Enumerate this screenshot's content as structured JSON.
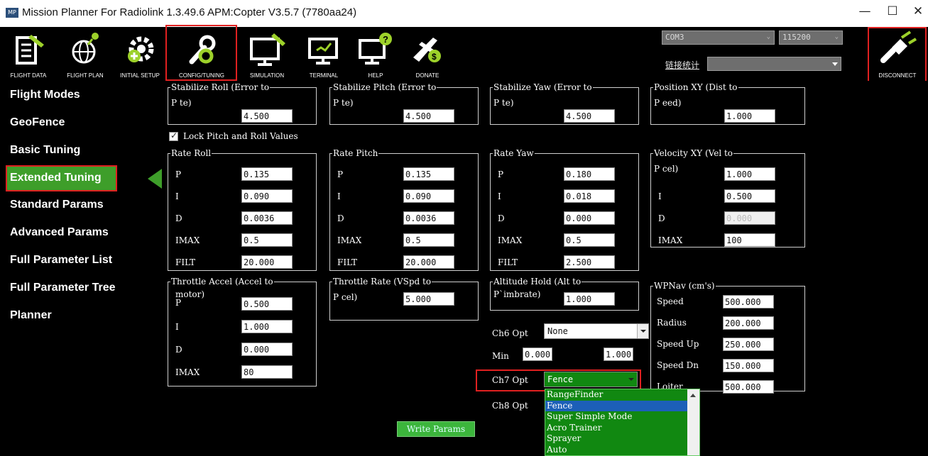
{
  "window": {
    "title": "Mission Planner For Radiolink 1.3.49.6 APM:Copter V3.5.7 (7780aa24)",
    "app_icon_text": "MP",
    "minimize": "—",
    "maximize": "☐",
    "close": "✕"
  },
  "toolbar": {
    "buttons": [
      {
        "label": "FLIGHT DATA",
        "icon": "flight-data-icon"
      },
      {
        "label": "FLIGHT PLAN",
        "icon": "flight-plan-icon"
      },
      {
        "label": "INITIAL SETUP",
        "icon": "initial-setup-icon"
      },
      {
        "label": "CONFIG/TUNING",
        "icon": "config-tuning-icon"
      },
      {
        "label": "SIMULATION",
        "icon": "simulation-icon"
      },
      {
        "label": "TERMINAL",
        "icon": "terminal-icon"
      },
      {
        "label": "HELP",
        "icon": "help-icon"
      },
      {
        "label": "DONATE",
        "icon": "donate-icon"
      }
    ],
    "com_port": "COM3",
    "baud_rate": "115200",
    "link_stats": "链接统计",
    "disconnect_label": "DISCONNECT"
  },
  "sidebar": {
    "items": [
      {
        "label": "Flight Modes"
      },
      {
        "label": "GeoFence"
      },
      {
        "label": "Basic Tuning"
      },
      {
        "label": "Extended Tuning"
      },
      {
        "label": "Standard Params"
      },
      {
        "label": "Advanced Params"
      },
      {
        "label": "Full Parameter List"
      },
      {
        "label": "Full Parameter Tree"
      },
      {
        "label": "Planner"
      }
    ],
    "selected": "Extended Tuning"
  },
  "content": {
    "stab_roll": {
      "legend": "Stabilize Roll (Error to",
      "label": "P te)",
      "value": "4.500"
    },
    "stab_pitch": {
      "legend": "Stabilize Pitch (Error to",
      "label": "P te)",
      "value": "4.500"
    },
    "stab_yaw": {
      "legend": "Stabilize Yaw (Error to",
      "label": "P te)",
      "value": "4.500"
    },
    "pos_xy": {
      "legend": "Position XY (Dist to",
      "label": "P eed)",
      "value": "1.000"
    },
    "lock_label": "Lock Pitch and Roll Values",
    "rate_roll": {
      "legend": "Rate Roll",
      "p": "0.135",
      "i": "0.090",
      "d": "0.0036",
      "imax": "0.5",
      "filt": "20.000"
    },
    "rate_pitch": {
      "legend": "Rate Pitch",
      "p": "0.135",
      "i": "0.090",
      "d": "0.0036",
      "imax": "0.5",
      "filt": "20.000"
    },
    "rate_yaw": {
      "legend": "Rate Yaw",
      "p": "0.180",
      "i": "0.018",
      "d": "0.000",
      "imax": "0.5",
      "filt": "2.500"
    },
    "vel_xy": {
      "legend": "Velocity XY (Vel to",
      "p_label": "P cel)",
      "p": "1.000",
      "i": "0.500",
      "d": "0.000",
      "imax": "100"
    },
    "labels": {
      "p": "P",
      "i": "I",
      "d": "D",
      "imax": "IMAX",
      "filt": "FILT"
    },
    "thr_accel": {
      "legend": "Throttle Accel (Accel to",
      "p_label": "motor)",
      "p_sub": "P",
      "p": "0.500",
      "i": "1.000",
      "d": "0.000",
      "imax": "80"
    },
    "thr_rate": {
      "legend": "Throttle Rate (VSpd to",
      "label": "P cel)",
      "value": "5.000"
    },
    "alt_hold": {
      "legend": "Altitude Hold (Alt to",
      "label": "P`imbrate)",
      "value": "1.000"
    },
    "ch6": {
      "label": "Ch6 Opt",
      "value": "None",
      "min_label": "Min",
      "min": "0.000",
      "max": "1.000"
    },
    "ch7": {
      "label": "Ch7 Opt",
      "value": "Fence"
    },
    "ch8": {
      "label": "Ch8 Opt"
    },
    "ch7_options": [
      "RangeFinder",
      "Fence",
      "Super Simple Mode",
      "Acro Trainer",
      "Sprayer",
      "Auto"
    ],
    "wpnav": {
      "legend": "WPNav (cm's)",
      "speed_label": "Speed",
      "speed": "500.000",
      "radius_label": "Radius",
      "radius": "200.000",
      "speed_up_label": "Speed Up",
      "speed_up": "250.000",
      "speed_dn_label": "Speed Dn",
      "speed_dn": "150.000",
      "loiter_label": "Loiter",
      "loiter": "500.000"
    },
    "write_params": "Write Params"
  },
  "colors": {
    "highlight": "#e02020",
    "ok_green": "#118811",
    "button_green": "#3cb53c"
  }
}
